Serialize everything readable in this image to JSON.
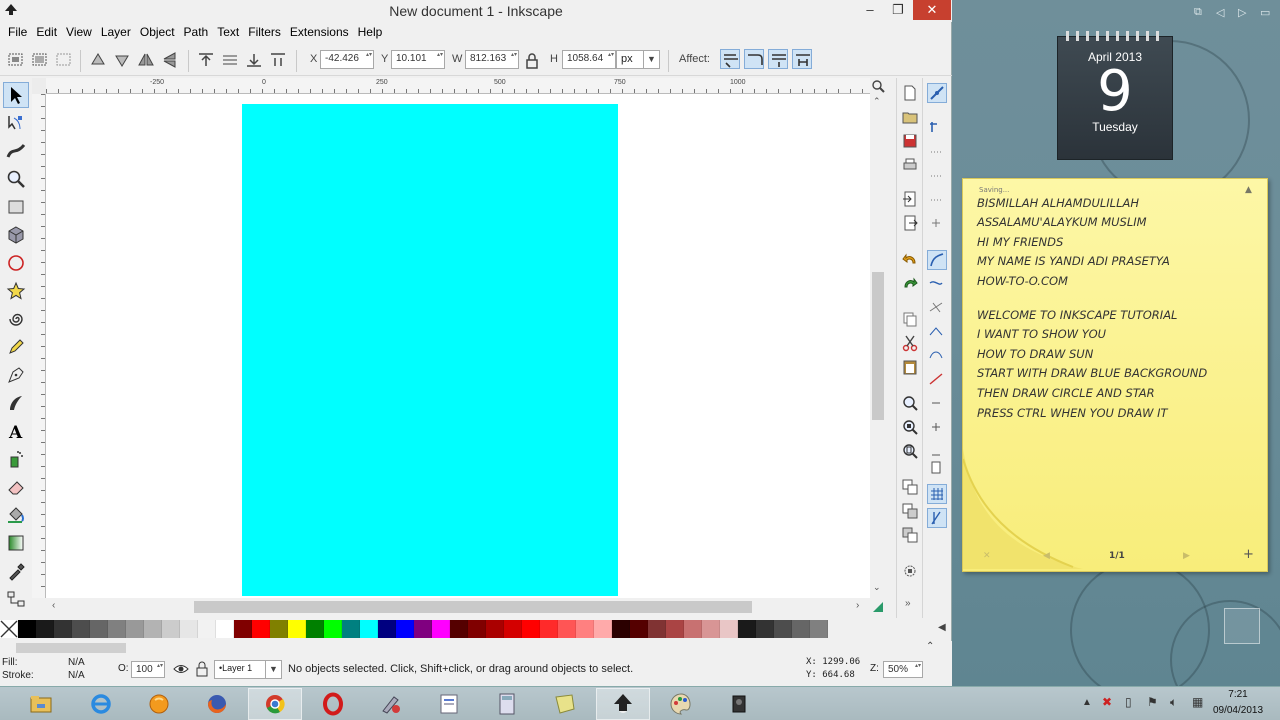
{
  "window": {
    "title": "New document 1 - Inkscape",
    "controls": {
      "minimize": "–",
      "maximize": "❐",
      "close": "✕"
    }
  },
  "menu": [
    "File",
    "Edit",
    "View",
    "Layer",
    "Object",
    "Path",
    "Text",
    "Filters",
    "Extensions",
    "Help"
  ],
  "toolbar": {
    "x_label": "X",
    "x_value": "-42.426",
    "y_label": "Y",
    "y_value": "10.101",
    "w_label": "W",
    "w_value": "812.163",
    "h_label": "H",
    "h_value": "1058.64",
    "unit": "px",
    "affect_label": "Affect:"
  },
  "rulers": {
    "horizontal": [
      "-250",
      "0",
      "250",
      "500",
      "750",
      "1000"
    ]
  },
  "status": {
    "fill_label": "Fill:",
    "fill_value": "N/A",
    "stroke_label": "Stroke:",
    "stroke_value": "N/A",
    "opacity_label": "O:",
    "opacity_value": "100",
    "layer": "•Layer 1",
    "message": "No objects selected. Click, Shift+click, or drag around objects to select.",
    "x_coord": "X: 1299.06",
    "y_coord": "Y:  664.68",
    "zoom_label": "Z:",
    "zoom": "50%"
  },
  "palette": [
    "#000000",
    "#1a1a1a",
    "#333333",
    "#4d4d4d",
    "#666666",
    "#808080",
    "#999999",
    "#b3b3b3",
    "#cccccc",
    "#e6e6e6",
    "#f2f2f2",
    "#ffffff",
    "#800000",
    "#ff0000",
    "#808000",
    "#ffff00",
    "#008000",
    "#00ff00",
    "#008080",
    "#00ffff",
    "#000080",
    "#0000ff",
    "#800080",
    "#ff00ff",
    "#550000",
    "#800000",
    "#aa0000",
    "#d40000",
    "#ff0000",
    "#ff2a2a",
    "#ff5555",
    "#ff8080",
    "#ffaaaa",
    "#2b0000",
    "#550000",
    "#803333",
    "#aa4444",
    "#c87171",
    "#d89595",
    "#e9c6c6",
    "#1a1a1a",
    "#333333",
    "#4d4d4d",
    "#666666",
    "#808080"
  ],
  "calendar": {
    "month": "April 2013",
    "day": "9",
    "weekday": "Tuesday"
  },
  "note": {
    "saving": "Saving...",
    "lines": [
      "BISMILLAH ALHAMDULILLAH",
      "ASSALAMU'ALAYKUM MUSLIM",
      "HI MY FRIENDS",
      "MY NAME IS YANDI ADI PRASETYA",
      "HOW-TO-O.COM",
      "WELCOME TO INKSCAPE TUTORIAL",
      "I WANT TO SHOW YOU",
      "HOW TO DRAW SUN",
      "START WITH DRAW BLUE BACKGROUND",
      "THEN DRAW CIRCLE AND STAR",
      "PRESS CTRL WHEN YOU DRAW IT"
    ],
    "page": "1/1",
    "add": "+",
    "close": "✕"
  },
  "taskbar": {
    "time": "7:21",
    "date": "09/04/2013"
  },
  "colors": {
    "canvas_rect": "#00ffff",
    "close_button": "#c7402f",
    "note_bg": "#fdf7a6"
  }
}
